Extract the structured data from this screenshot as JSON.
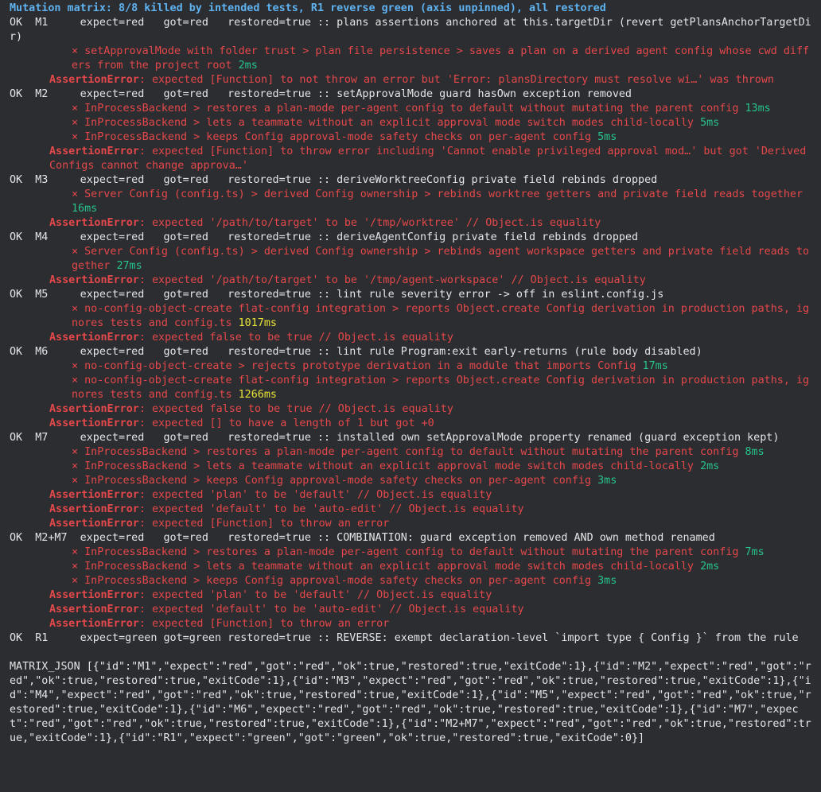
{
  "terminal": {
    "header": "Mutation matrix: 8/8 killed by intended tests, R1 reverse green (axis unpinned), all restored",
    "lines": [
      {
        "t": "ok",
        "text": "OK  M1     expect=red   got=red   restored=true :: plans assertions anchored at this.targetDir (revert getPlansAnchorTargetDir)"
      },
      {
        "t": "fail",
        "text": "× setApprovalMode with folder trust > plan file persistence > saves a plan on a derived agent config whose cwd differs from the project root",
        "dur": "2ms",
        "dc": "g"
      },
      {
        "t": "assert",
        "label": "AssertionError",
        "text": ": expected [Function] to not throw an error but 'Error: plansDirectory must resolve wi…' was thrown"
      },
      {
        "t": "ok",
        "text": "OK  M2     expect=red   got=red   restored=true :: setApprovalMode guard hasOwn exception removed"
      },
      {
        "t": "fail",
        "text": "× InProcessBackend > restores a plan-mode per-agent config to default without mutating the parent config",
        "dur": "13ms",
        "dc": "g"
      },
      {
        "t": "fail",
        "text": "× InProcessBackend > lets a teammate without an explicit approval mode switch modes child-locally",
        "dur": "5ms",
        "dc": "g"
      },
      {
        "t": "fail",
        "text": "× InProcessBackend > keeps Config approval-mode safety checks on per-agent config",
        "dur": "5ms",
        "dc": "g"
      },
      {
        "t": "assert",
        "label": "AssertionError",
        "text": ": expected [Function] to throw error including 'Cannot enable privileged approval mod…' but got 'Derived Configs cannot change approva…'"
      },
      {
        "t": "ok",
        "text": "OK  M3     expect=red   got=red   restored=true :: deriveWorktreeConfig private field rebinds dropped"
      },
      {
        "t": "fail",
        "text": "× Server Config (config.ts) > derived Config ownership > rebinds worktree getters and private field reads together",
        "dur": "16ms",
        "dc": "g"
      },
      {
        "t": "assert",
        "label": "AssertionError",
        "text": ": expected '/path/to/target' to be '/tmp/worktree' // Object.is equality"
      },
      {
        "t": "ok",
        "text": "OK  M4     expect=red   got=red   restored=true :: deriveAgentConfig private field rebinds dropped"
      },
      {
        "t": "fail",
        "text": "× Server Config (config.ts) > derived Config ownership > rebinds agent workspace getters and private field reads together",
        "dur": "27ms",
        "dc": "g"
      },
      {
        "t": "assert",
        "label": "AssertionError",
        "text": ": expected '/path/to/target' to be '/tmp/agent-workspace' // Object.is equality"
      },
      {
        "t": "ok",
        "text": "OK  M5     expect=red   got=red   restored=true :: lint rule severity error -> off in eslint.config.js"
      },
      {
        "t": "fail",
        "text": "× no-config-object-create flat-config integration > reports Object.create Config derivation in production paths, ignores tests and config.ts",
        "dur": "1017ms",
        "dc": "y"
      },
      {
        "t": "assert",
        "label": "AssertionError",
        "text": ": expected false to be true // Object.is equality"
      },
      {
        "t": "ok",
        "text": "OK  M6     expect=red   got=red   restored=true :: lint rule Program:exit early-returns (rule body disabled)"
      },
      {
        "t": "fail",
        "text": "× no-config-object-create > rejects prototype derivation in a module that imports Config",
        "dur": "17ms",
        "dc": "g"
      },
      {
        "t": "fail",
        "text": "× no-config-object-create flat-config integration > reports Object.create Config derivation in production paths, ignores tests and config.ts",
        "dur": "1266ms",
        "dc": "y"
      },
      {
        "t": "assert",
        "label": "AssertionError",
        "text": ": expected false to be true // Object.is equality"
      },
      {
        "t": "assert",
        "label": "AssertionError",
        "text": ": expected [] to have a length of 1 but got +0"
      },
      {
        "t": "ok",
        "text": "OK  M7     expect=red   got=red   restored=true :: installed own setApprovalMode property renamed (guard exception kept)"
      },
      {
        "t": "fail",
        "text": "× InProcessBackend > restores a plan-mode per-agent config to default without mutating the parent config",
        "dur": "8ms",
        "dc": "g"
      },
      {
        "t": "fail",
        "text": "× InProcessBackend > lets a teammate without an explicit approval mode switch modes child-locally",
        "dur": "2ms",
        "dc": "g"
      },
      {
        "t": "fail",
        "text": "× InProcessBackend > keeps Config approval-mode safety checks on per-agent config",
        "dur": "3ms",
        "dc": "g"
      },
      {
        "t": "assert",
        "label": "AssertionError",
        "text": ": expected 'plan' to be 'default' // Object.is equality"
      },
      {
        "t": "assert",
        "label": "AssertionError",
        "text": ": expected 'default' to be 'auto-edit' // Object.is equality"
      },
      {
        "t": "assert",
        "label": "AssertionError",
        "text": ": expected [Function] to throw an error"
      },
      {
        "t": "ok",
        "text": "OK  M2+M7  expect=red   got=red   restored=true :: COMBINATION: guard exception removed AND own method renamed"
      },
      {
        "t": "fail",
        "text": "× InProcessBackend > restores a plan-mode per-agent config to default without mutating the parent config",
        "dur": "7ms",
        "dc": "g"
      },
      {
        "t": "fail",
        "text": "× InProcessBackend > lets a teammate without an explicit approval mode switch modes child-locally",
        "dur": "2ms",
        "dc": "g"
      },
      {
        "t": "fail",
        "text": "× InProcessBackend > keeps Config approval-mode safety checks on per-agent config",
        "dur": "3ms",
        "dc": "g"
      },
      {
        "t": "assert",
        "label": "AssertionError",
        "text": ": expected 'plan' to be 'default' // Object.is equality"
      },
      {
        "t": "assert",
        "label": "AssertionError",
        "text": ": expected 'default' to be 'auto-edit' // Object.is equality"
      },
      {
        "t": "assert",
        "label": "AssertionError",
        "text": ": expected [Function] to throw an error"
      },
      {
        "t": "ok",
        "text": "OK  R1     expect=green got=green restored=true :: REVERSE: exempt declaration-level `import type { Config }` from the rule"
      },
      {
        "t": "blank",
        "text": ""
      },
      {
        "t": "ok",
        "text": "MATRIX_JSON [{\"id\":\"M1\",\"expect\":\"red\",\"got\":\"red\",\"ok\":true,\"restored\":true,\"exitCode\":1},{\"id\":\"M2\",\"expect\":\"red\",\"got\":\"red\",\"ok\":true,\"restored\":true,\"exitCode\":1},{\"id\":\"M3\",\"expect\":\"red\",\"got\":\"red\",\"ok\":true,\"restored\":true,\"exitCode\":1},{\"id\":\"M4\",\"expect\":\"red\",\"got\":\"red\",\"ok\":true,\"restored\":true,\"exitCode\":1},{\"id\":\"M5\",\"expect\":\"red\",\"got\":\"red\",\"ok\":true,\"restored\":true,\"exitCode\":1},{\"id\":\"M6\",\"expect\":\"red\",\"got\":\"red\",\"ok\":true,\"restored\":true,\"exitCode\":1},{\"id\":\"M7\",\"expect\":\"red\",\"got\":\"red\",\"ok\":true,\"restored\":true,\"exitCode\":1},{\"id\":\"M2+M7\",\"expect\":\"red\",\"got\":\"red\",\"ok\":true,\"restored\":true,\"exitCode\":1},{\"id\":\"R1\",\"expect\":\"green\",\"got\":\"green\",\"ok\":true,\"restored\":true,\"exitCode\":0}]"
      }
    ]
  },
  "colors": {
    "background": "#2b2d31",
    "text": "#e4e5e7",
    "header": "#5fb2ef",
    "fail": "#e5484a",
    "duration_fast": "#28c38a",
    "duration_slow": "#e8e237"
  }
}
